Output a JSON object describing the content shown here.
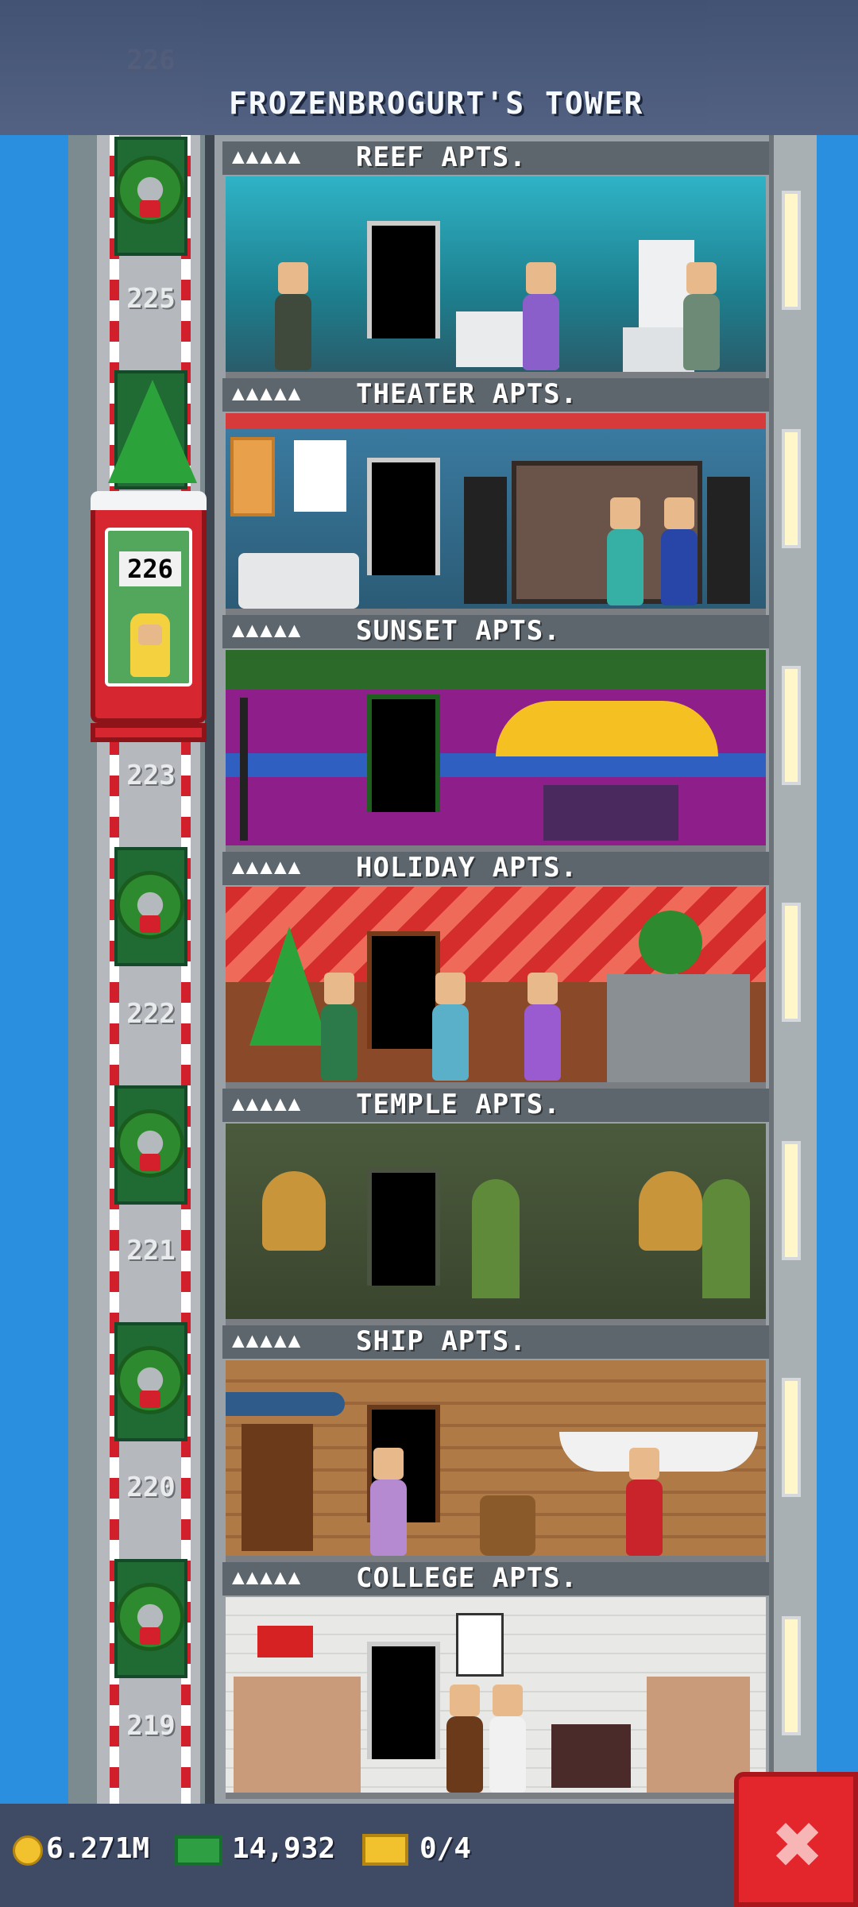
{
  "header": {
    "title": "FROZENBROGURT'S TOWER"
  },
  "shaft_floor_numbers": [
    {
      "label": "226"
    },
    {
      "label": "225"
    },
    {
      "label": "223"
    },
    {
      "label": "222"
    },
    {
      "label": "221"
    },
    {
      "label": "220"
    },
    {
      "label": "219"
    }
  ],
  "elevator": {
    "display": "226"
  },
  "floors": [
    {
      "stars": "▲▲▲▲▲",
      "name": "REEF APTS."
    },
    {
      "stars": "▲▲▲▲▲",
      "name": "THEATER APTS."
    },
    {
      "stars": "▲▲▲▲▲",
      "name": "SUNSET APTS."
    },
    {
      "stars": "▲▲▲▲▲",
      "name": "HOLIDAY APTS."
    },
    {
      "stars": "▲▲▲▲▲",
      "name": "TEMPLE APTS."
    },
    {
      "stars": "▲▲▲▲▲",
      "name": "SHIP APTS."
    },
    {
      "stars": "▲▲▲▲▲",
      "name": "COLLEGE APTS."
    }
  ],
  "bottom_bar": {
    "coins": "6.271M",
    "bux": "14,932",
    "tickets": "0/4",
    "coin_icon": "coin-icon",
    "bux_icon": "tower-bux-icon",
    "ticket_icon": "golden-ticket-icon",
    "close_icon": "close-icon"
  },
  "colors": {
    "sky": "#2b8fe0",
    "accent_red": "#e2262c",
    "header": "#43506f"
  }
}
